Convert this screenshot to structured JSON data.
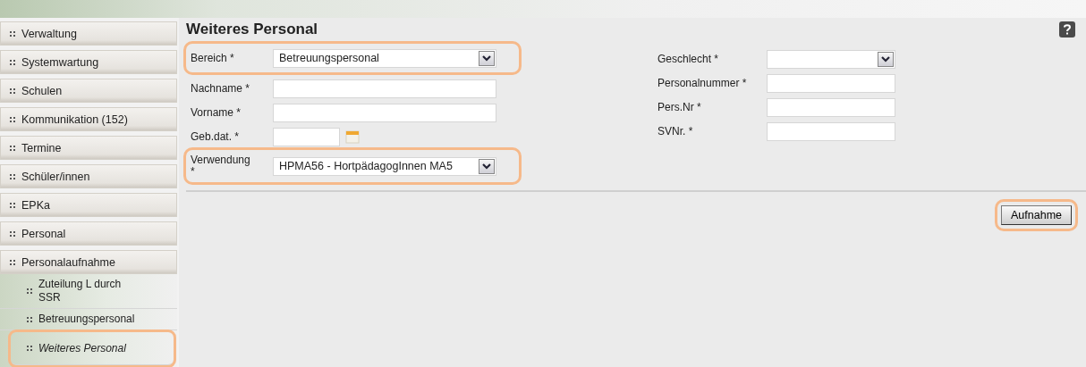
{
  "sidebar": {
    "items": [
      {
        "label": "Verwaltung",
        "selected": false,
        "highlighted": false
      },
      {
        "label": "Systemwartung",
        "selected": false,
        "highlighted": false
      },
      {
        "label": "Schulen",
        "selected": false,
        "highlighted": false
      },
      {
        "label": "Kommunikation (152)",
        "selected": false,
        "highlighted": false
      },
      {
        "label": "Termine",
        "selected": false,
        "highlighted": false
      },
      {
        "label": "Schüler/innen",
        "selected": false,
        "highlighted": false
      },
      {
        "label": "EPKa",
        "selected": false,
        "highlighted": false
      },
      {
        "label": "Personal",
        "selected": false,
        "highlighted": false
      },
      {
        "label": "Personalaufnahme",
        "selected": false,
        "highlighted": false,
        "children": [
          {
            "label": "Zuteilung L durch SSR",
            "selected": false,
            "highlighted": false
          },
          {
            "label": "Betreuungspersonal",
            "selected": false,
            "highlighted": false
          },
          {
            "label": "Weiteres Personal",
            "selected": true,
            "highlighted": true
          }
        ]
      }
    ]
  },
  "page": {
    "title": "Weiteres Personal"
  },
  "form": {
    "left": [
      {
        "label": "Bereich *",
        "kind": "select",
        "value": "Betreuungspersonal",
        "highlighted": true
      },
      {
        "label": "Nachname *",
        "kind": "text",
        "highlighted": false
      },
      {
        "label": "Vorname *",
        "kind": "text",
        "highlighted": false
      },
      {
        "label": "Geb.dat. *",
        "kind": "date",
        "highlighted": false
      },
      {
        "label": "Verwendung\n*",
        "kind": "select",
        "value": "HPMA56 - HortpädagogInnen MA5",
        "highlighted": true
      }
    ],
    "right": [
      {
        "label": "Geschlecht *",
        "kind": "select",
        "highlighted": false
      },
      {
        "label": "Personalnummer *",
        "kind": "text",
        "highlighted": false
      },
      {
        "label": "Pers.Nr *",
        "kind": "text",
        "highlighted": false
      },
      {
        "label": "SVNr. *",
        "kind": "text",
        "highlighted": false
      }
    ]
  },
  "submit": {
    "label": "Aufnahme",
    "highlighted": true
  }
}
